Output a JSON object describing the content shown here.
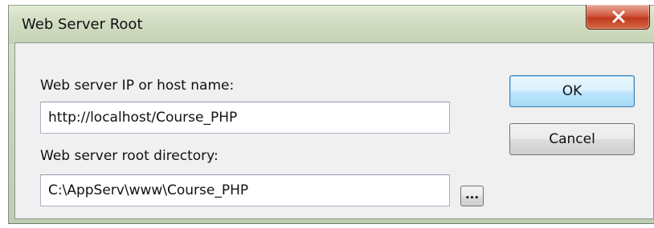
{
  "window": {
    "title": "Web Server Root",
    "close_icon": "close-icon"
  },
  "form": {
    "ip_label": "Web server IP or host name:",
    "ip_value": "http://localhost/Course_PHP",
    "root_label": "Web server root directory:",
    "root_value": "C:\\AppServ\\www\\Course_PHP",
    "browse_label": "..."
  },
  "buttons": {
    "ok": "OK",
    "cancel": "Cancel"
  },
  "colors": {
    "close_button": "#c9452b",
    "ok_button_border": "#3c7fb1",
    "dialog_background": "#f0f0f0"
  }
}
